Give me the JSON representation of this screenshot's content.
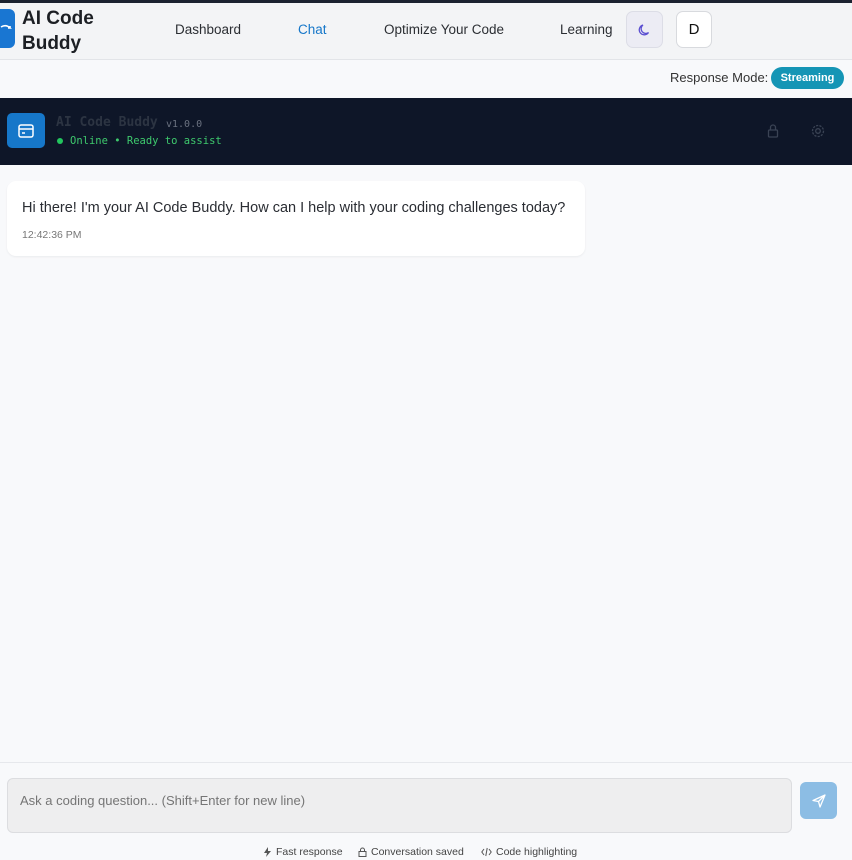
{
  "brand": {
    "name": "AI Code Buddy"
  },
  "nav": {
    "links": [
      "Dashboard",
      "Chat",
      "Optimize Your Code",
      "Learning"
    ],
    "active": "Chat",
    "avatar_initial": "D"
  },
  "mode": {
    "label": "Response Mode:",
    "value": "Streaming"
  },
  "bot": {
    "name": "AI Code Buddy",
    "version": "v1.0.0",
    "status": "Online • Ready to assist"
  },
  "messages": [
    {
      "text": "Hi there! I'm your AI Code Buddy. How can I help with your coding challenges today?",
      "time": "12:42:36 PM"
    }
  ],
  "input": {
    "placeholder": "Ask a coding question... (Shift+Enter for new line)"
  },
  "footer": [
    "Fast response",
    "Conversation saved",
    "Code highlighting"
  ],
  "colors": {
    "accent": "#1677c9",
    "header_bg": "#0e1628",
    "badge": "#1595b5",
    "online": "#22c55e"
  },
  "icons": {
    "logo": "code-arrow-icon",
    "theme": "moon-icon",
    "bot": "terminal-window-icon",
    "lock": "lock-icon",
    "settings": "gear-icon",
    "send": "send-icon"
  }
}
